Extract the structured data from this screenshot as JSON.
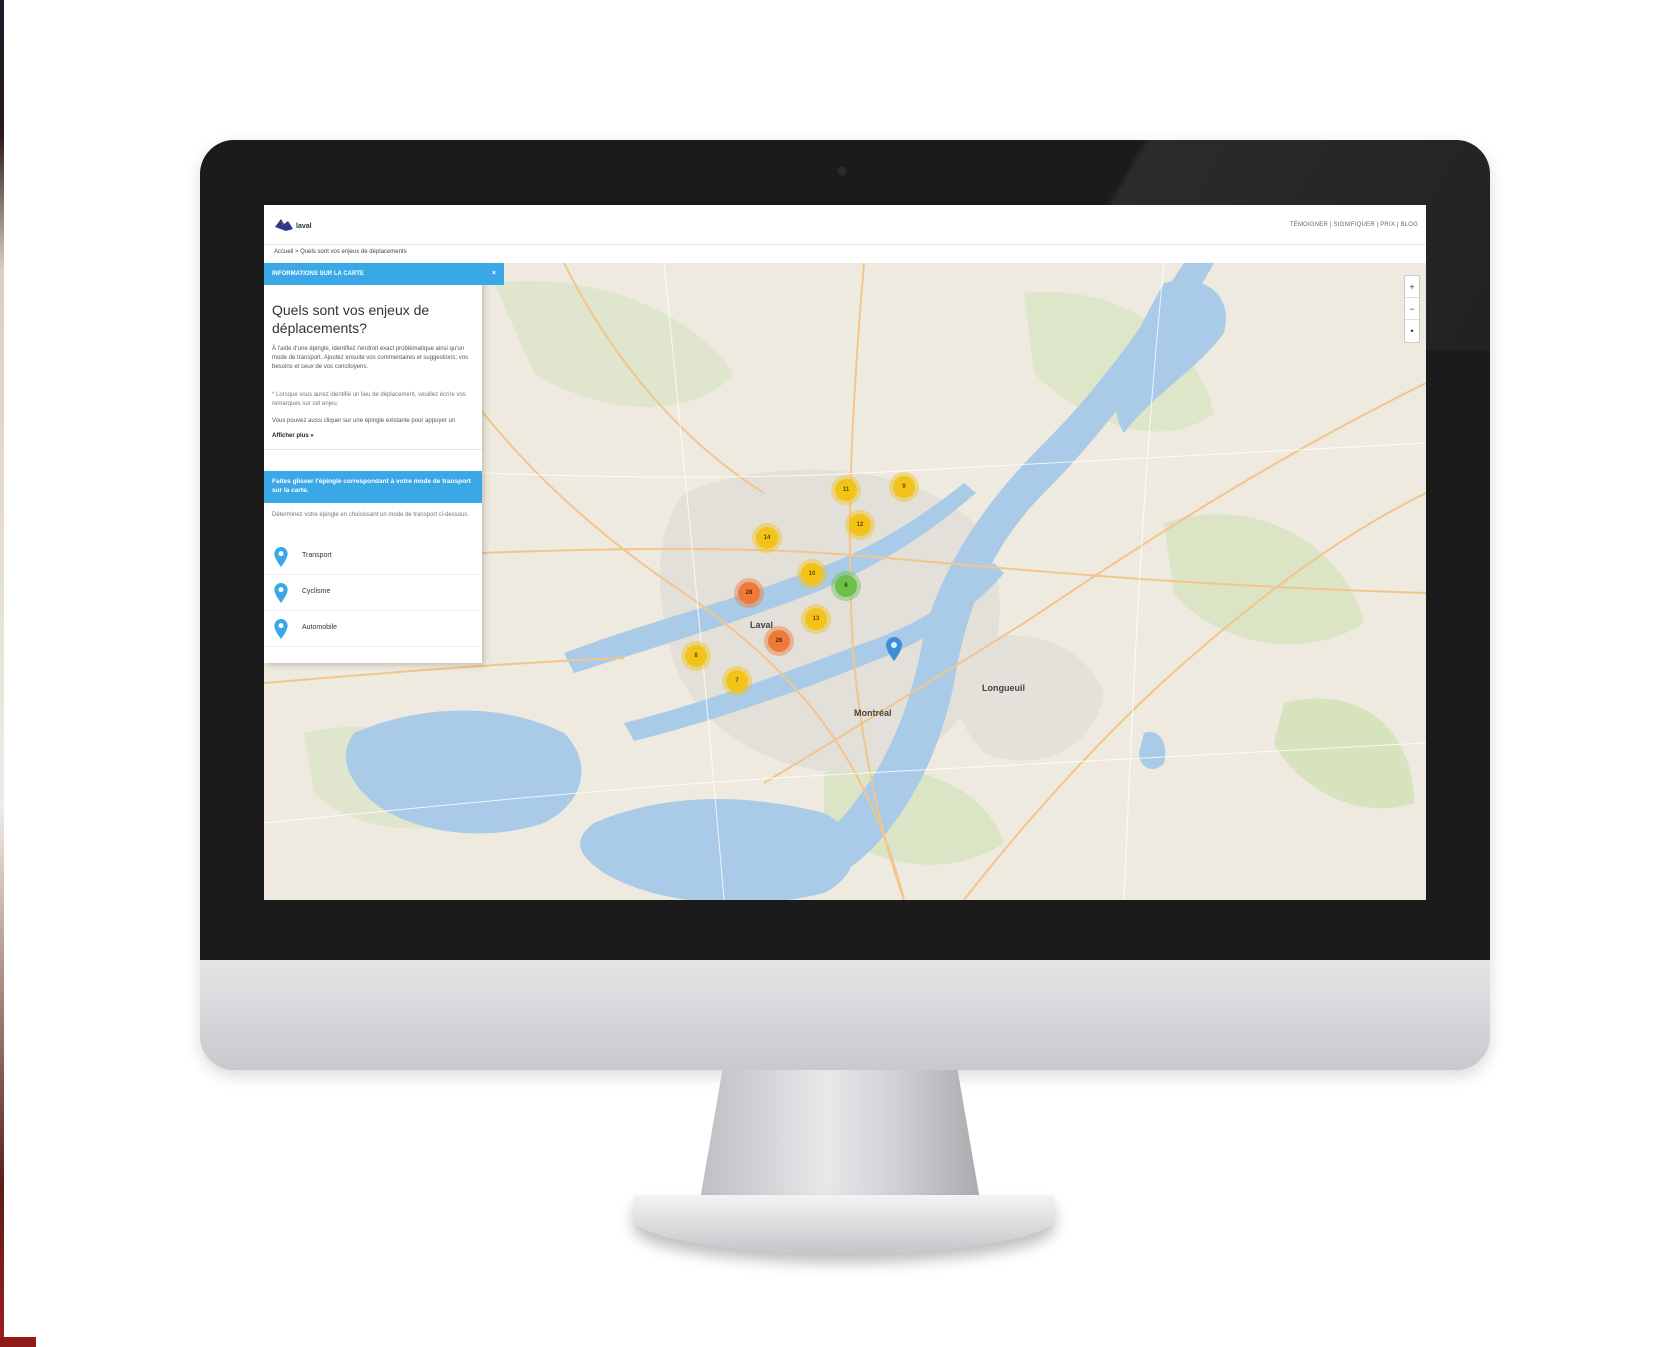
{
  "header": {
    "logo_text": "laval",
    "nav_text": "TÉMOIGNER | SIGNIFIQUER | PRIX | BLOG"
  },
  "breadcrumb": "Accueil > Quels sont vos enjeux de déplacements",
  "panel": {
    "header_label": "INFORMATIONS SUR LA CARTE",
    "close_label": "×",
    "title": "Quels sont vos enjeux de déplacements?",
    "body": "À l'aide d'une épingle, identifiez l'endroit exact problématique ainsi qu'un mode de transport. Ajoutez ensuite vos commentaires et suggestions; vos besoins et ceux de vos concitoyens.",
    "note": "* Lorsque vous aurez identifié un lieu de déplacement, veuillez écrire vos remarques sur cet enjeu.",
    "note2": "Vous pouvez aussi cliquer sur une épingle existante pour appuyer un",
    "link": "Afficher plus »",
    "cta": "Faites glisser l'épingle correspondant à votre mode de transport sur la carte.",
    "sub": "Déterminez votre épingle en choisissant un mode de transport ci-dessous.",
    "modes": [
      {
        "label": "Transport"
      },
      {
        "label": "Cyclisme"
      },
      {
        "label": "Automobile"
      }
    ]
  },
  "map": {
    "zoom_in": "+",
    "zoom_out": "−",
    "locate": "•",
    "cities": [
      {
        "name": "Laval"
      },
      {
        "name": "Montréal"
      },
      {
        "name": "Longueuil"
      }
    ],
    "clusters": [
      {
        "label": "11",
        "color": "yellow"
      },
      {
        "label": "9",
        "color": "yellow"
      },
      {
        "label": "14",
        "color": "yellow"
      },
      {
        "label": "12",
        "color": "yellow"
      },
      {
        "label": "10",
        "color": "yellow"
      },
      {
        "label": "6",
        "color": "green"
      },
      {
        "label": "28",
        "color": "orange"
      },
      {
        "label": "13",
        "color": "yellow"
      },
      {
        "label": "26",
        "color": "orange"
      },
      {
        "label": "8",
        "color": "yellow"
      },
      {
        "label": "7",
        "color": "yellow"
      }
    ]
  },
  "colors": {
    "accent": "#3aa8e6",
    "cluster_yellow": "#f2c318",
    "cluster_orange": "#ee7a3a",
    "cluster_green": "#6cc04a",
    "water": "#a9cbe8",
    "land": "#eeeadf"
  },
  "icons": [
    "logo-icon",
    "map-pin-icon",
    "close-icon"
  ]
}
